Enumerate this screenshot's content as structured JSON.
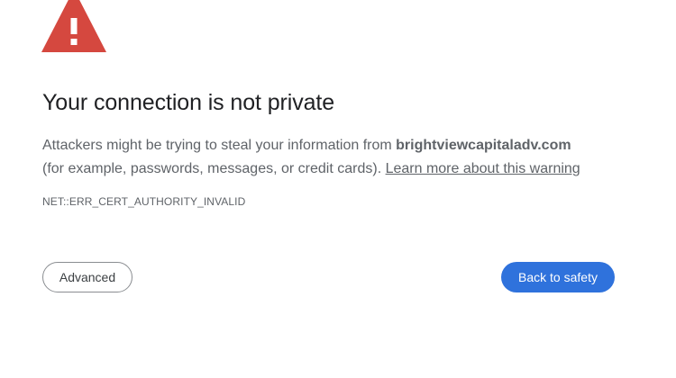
{
  "warning": {
    "icon": "warning-triangle-icon",
    "color": "#d5483f"
  },
  "title": "Your connection is not private",
  "message": {
    "line1_prefix": "Attackers might be trying to steal your information from ",
    "domain": "brightviewcapitaladv.com",
    "line2_prefix": "(for example, passwords, messages, or credit cards). ",
    "learn_more": "Learn more about this warning"
  },
  "error_code": "NET::ERR_CERT_AUTHORITY_INVALID",
  "buttons": {
    "advanced": "Advanced",
    "back_to_safety": "Back to safety"
  },
  "colors": {
    "primary_button": "#2f72dc",
    "text_secondary": "#5f6368"
  }
}
